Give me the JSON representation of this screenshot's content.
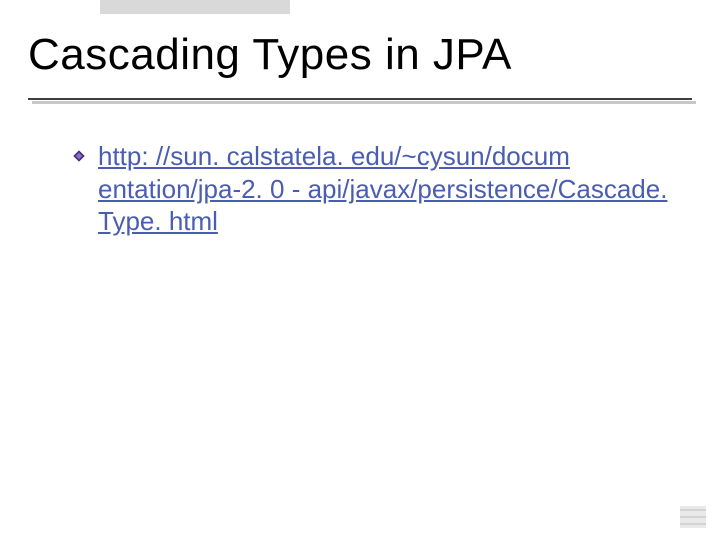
{
  "slide": {
    "title": "Cascading Types in JPA",
    "bullet": {
      "link_text": "http: //sun. calstatela. edu/~cysun/docum entation/jpa-2. 0 - api/javax/persistence/Cascade. Type. html"
    }
  },
  "colors": {
    "link": "#4a5db0",
    "bullet_fill": "#5a3d99",
    "bullet_edge": "#3a2766"
  }
}
